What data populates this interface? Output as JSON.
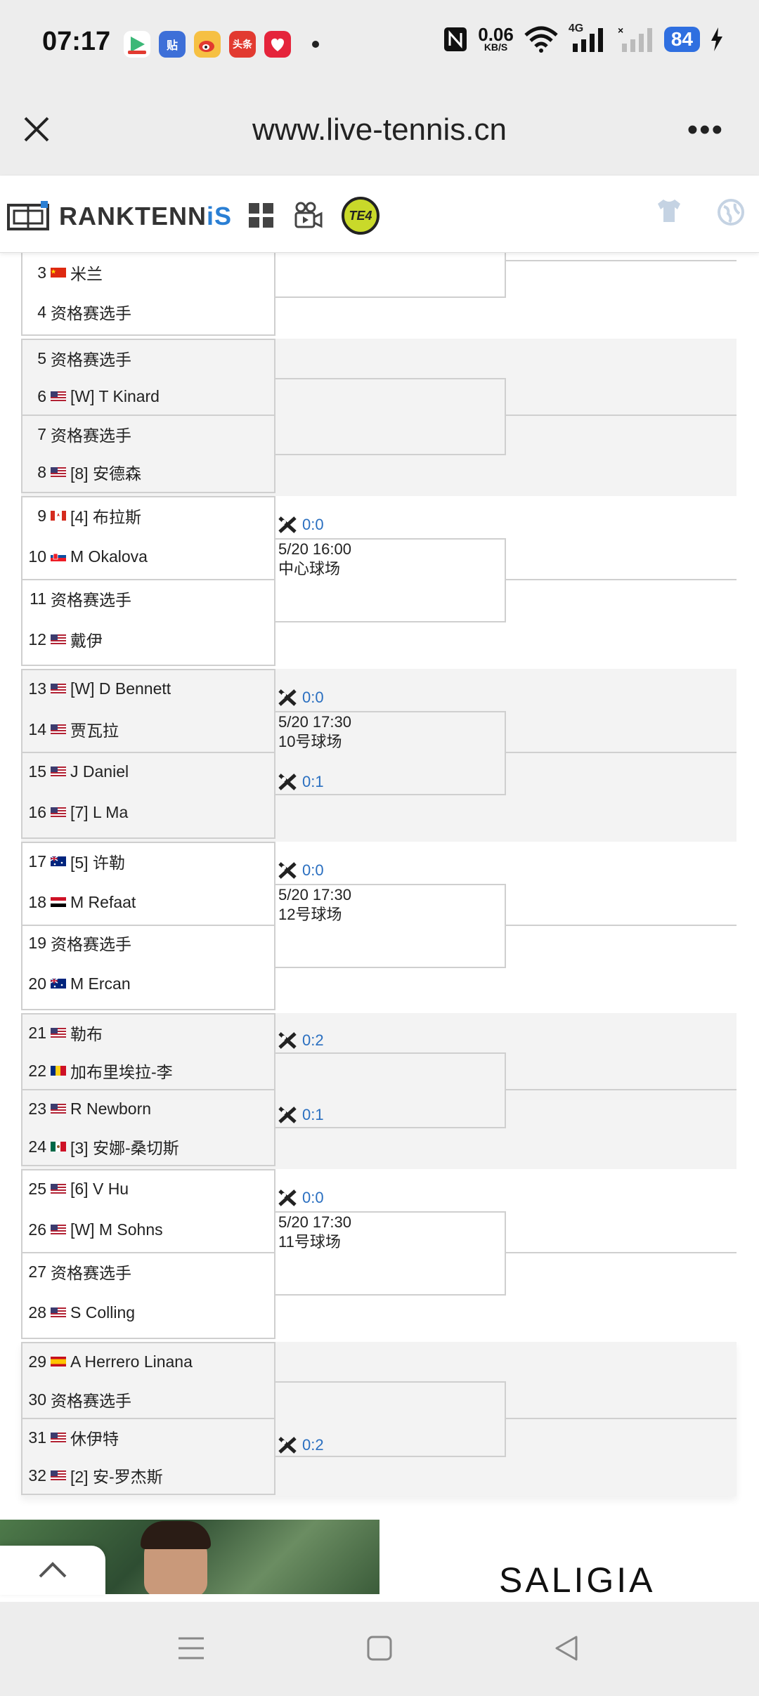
{
  "status_bar": {
    "time": "07:17",
    "net_speed_value": "0.06",
    "net_speed_unit": "KB/S",
    "network": "4G",
    "battery": "84",
    "apps": [
      {
        "icon": "video-app-icon",
        "color": "#3cb878"
      },
      {
        "icon": "tieba-app-icon",
        "label": "贴",
        "color": "#3d6fd8"
      },
      {
        "icon": "weibo-app-icon",
        "color": "#f0a020"
      },
      {
        "icon": "toutiao-app-icon",
        "label": "头条",
        "color": "#e23a30"
      },
      {
        "icon": "red-app-icon",
        "color": "#e5243b"
      }
    ]
  },
  "browser": {
    "url": "www.live-tennis.cn"
  },
  "site": {
    "logo_part1": "RANKTENN",
    "logo_part2": "iS",
    "te4_label": "TE4"
  },
  "bracket": {
    "groups": [
      {
        "players": [
          {
            "seed": "3",
            "flag": "cn",
            "name": "米兰"
          },
          {
            "seed": "4",
            "flag": "",
            "name": "资格赛选手"
          }
        ]
      },
      {
        "players": [
          {
            "seed": "5",
            "flag": "",
            "name": "资格赛选手"
          },
          {
            "seed": "6",
            "flag": "us",
            "name": "[W] T Kinard"
          },
          {
            "seed": "7",
            "flag": "",
            "name": "资格赛选手"
          },
          {
            "seed": "8",
            "flag": "us",
            "name": "[8] 安德森"
          }
        ]
      },
      {
        "players": [
          {
            "seed": "9",
            "flag": "ca",
            "name": "[4] 布拉斯"
          },
          {
            "seed": "10",
            "flag": "sk",
            "name": "M Okalova"
          },
          {
            "seed": "11",
            "flag": "",
            "name": "资格赛选手"
          },
          {
            "seed": "12",
            "flag": "us",
            "name": "戴伊"
          }
        ],
        "score_top": "0:0",
        "datetime": "5/20 16:00",
        "court": "中心球场"
      },
      {
        "players": [
          {
            "seed": "13",
            "flag": "us",
            "name": "[W] D Bennett"
          },
          {
            "seed": "14",
            "flag": "us",
            "name": "贾瓦拉"
          },
          {
            "seed": "15",
            "flag": "us",
            "name": "J Daniel"
          },
          {
            "seed": "16",
            "flag": "us",
            "name": "[7] L Ma"
          }
        ],
        "score_top": "0:0",
        "datetime": "5/20 17:30",
        "court": "10号球场",
        "score_bottom": "0:1"
      },
      {
        "players": [
          {
            "seed": "17",
            "flag": "au",
            "name": "[5] 许勒"
          },
          {
            "seed": "18",
            "flag": "eg",
            "name": "M Refaat"
          },
          {
            "seed": "19",
            "flag": "",
            "name": "资格赛选手"
          },
          {
            "seed": "20",
            "flag": "au",
            "name": "M Ercan"
          }
        ],
        "score_top": "0:0",
        "datetime": "5/20 17:30",
        "court": "12号球场"
      },
      {
        "players": [
          {
            "seed": "21",
            "flag": "us",
            "name": "勒布"
          },
          {
            "seed": "22",
            "flag": "ro",
            "name": "加布里埃拉-李"
          },
          {
            "seed": "23",
            "flag": "us",
            "name": "R Newborn"
          },
          {
            "seed": "24",
            "flag": "mx",
            "name": "[3] 安娜-桑切斯"
          }
        ],
        "score_top": "0:2",
        "score_bottom": "0:1"
      },
      {
        "players": [
          {
            "seed": "25",
            "flag": "us",
            "name": "[6] V Hu"
          },
          {
            "seed": "26",
            "flag": "us",
            "name": "[W] M Sohns"
          },
          {
            "seed": "27",
            "flag": "",
            "name": "资格赛选手"
          },
          {
            "seed": "28",
            "flag": "us",
            "name": "S Colling"
          }
        ],
        "score_top": "0:0",
        "datetime": "5/20 17:30",
        "court": "11号球场"
      },
      {
        "players": [
          {
            "seed": "29",
            "flag": "es",
            "name": "A Herrero Linana"
          },
          {
            "seed": "30",
            "flag": "",
            "name": "资格赛选手"
          },
          {
            "seed": "31",
            "flag": "us",
            "name": "休伊特"
          },
          {
            "seed": "32",
            "flag": "us",
            "name": "[2] 安-罗杰斯"
          }
        ],
        "score_bottom": "0:2"
      }
    ]
  },
  "ad": {
    "brand": "SALIGIA"
  },
  "colors": {
    "accent": "#2a7fd4",
    "score": "#2a6fc0",
    "border": "#cfcfcf"
  }
}
